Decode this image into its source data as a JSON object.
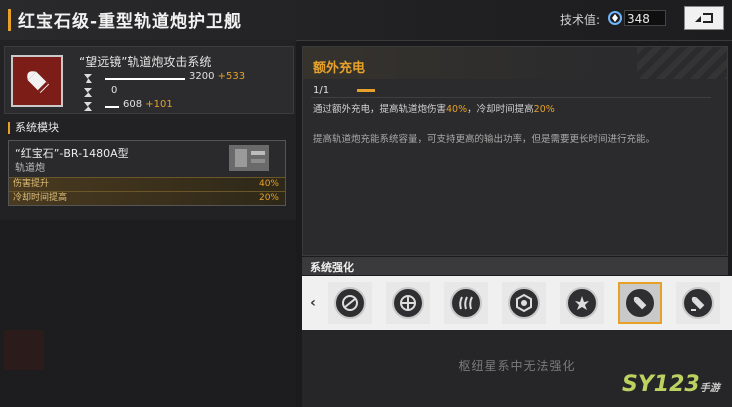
{
  "header": {
    "title": "红宝石级-重型轨道炮护卫舰",
    "tech_label": "技术值:",
    "tech_value": "348",
    "back_label": "◂⊐"
  },
  "weapon": {
    "name": "“望远镜”轨道炮攻击系统",
    "stats": [
      {
        "icon": "attack-icon",
        "value": "3200",
        "bonus": "+533",
        "fill": 0.65
      },
      {
        "icon": "range-icon",
        "value": "0",
        "bonus": "",
        "fill": 0.0
      },
      {
        "icon": "cooldown-icon",
        "value": "608",
        "bonus": "+101",
        "fill": 0.1
      }
    ]
  },
  "modules": {
    "section_label": "系统模块",
    "item": {
      "name": "“红宝石”-BR-1480A型",
      "type": "轨道炮",
      "rows": [
        {
          "label": "伤害提升",
          "value": "40%"
        },
        {
          "label": "冷却时间提高",
          "value": "20%"
        }
      ]
    }
  },
  "upgrade": {
    "title": "额外充电",
    "level": "1/1",
    "desc1_a": "通过额外充电，提高轨道炮伤害",
    "desc1_b": "40%",
    "desc1_c": "，冷却时间提高",
    "desc1_d": "20%",
    "desc2": "提高轨道炮充能系统容量，可支持更高的输出功率，但是需要更长时间进行充能。"
  },
  "enhancement": {
    "label": "系统强化",
    "slots": [
      "upgrade-icon-1",
      "upgrade-icon-2",
      "upgrade-icon-3",
      "upgrade-icon-4",
      "upgrade-icon-5",
      "upgrade-icon-6",
      "upgrade-icon-7"
    ],
    "selected_index": 5,
    "message": "枢纽星系中无法强化"
  },
  "watermark": {
    "text": "SY123",
    "sub": "手游"
  },
  "colors": {
    "accent": "#e6a12a",
    "weapon_bg": "#7d1d17"
  }
}
